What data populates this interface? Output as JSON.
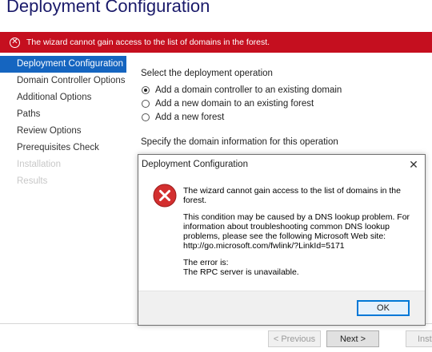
{
  "window": {
    "title": "Deployment Configuration"
  },
  "banner": {
    "message": "The wizard cannot gain access to the list of domains in the forest."
  },
  "sidebar": {
    "items": [
      {
        "label": "Deployment Configuration"
      },
      {
        "label": "Domain Controller Options"
      },
      {
        "label": "Additional Options"
      },
      {
        "label": "Paths"
      },
      {
        "label": "Review Options"
      },
      {
        "label": "Prerequisites Check"
      },
      {
        "label": "Installation"
      },
      {
        "label": "Results"
      }
    ]
  },
  "main": {
    "operation_label": "Select the deployment operation",
    "options": [
      {
        "label": "Add a domain controller to an existing domain",
        "selected": true
      },
      {
        "label": "Add a new domain to an existing forest",
        "selected": false
      },
      {
        "label": "Add a new forest",
        "selected": false
      }
    ],
    "domain_info_label": "Specify the domain information for this operation"
  },
  "dialog": {
    "title": "Deployment Configuration",
    "heading": "The wizard cannot gain access to the list of domains in the forest.",
    "detail": "This condition may be caused by a DNS lookup problem. For information about troubleshooting common DNS lookup problems, please see the following Microsoft Web site: http://go.microsoft.com/fwlink/?LinkId=5171",
    "error_intro": "The error is:",
    "error_text": "The RPC server is unavailable.",
    "ok_label": "OK"
  },
  "footer": {
    "previous_label": "< Previous",
    "next_label": "Next >",
    "install_label": "Inst"
  },
  "colors": {
    "banner": "#c50f1f",
    "active_nav": "#1565c0",
    "title": "#1a1a6a",
    "error_icon": "#d32f2f"
  }
}
